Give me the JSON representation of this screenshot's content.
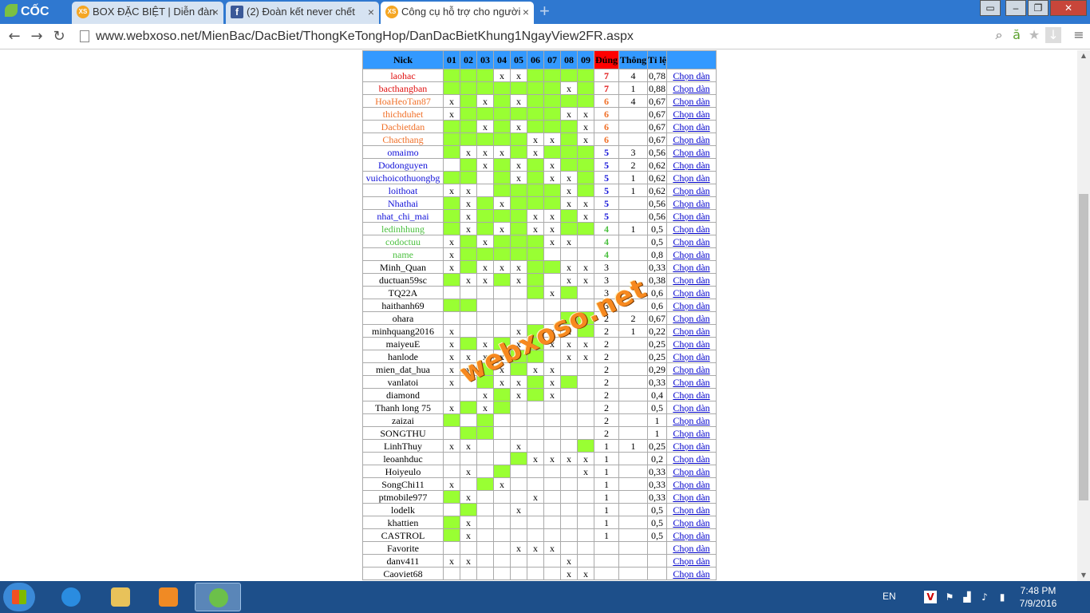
{
  "browser": {
    "brand": "CỐC CỐC",
    "tabs": [
      {
        "label": "BOX ĐẶC BIỆT | Diễn đàn",
        "icon": "xs-icon",
        "fav": "XS"
      },
      {
        "label": "(2) Đoàn kết never chết",
        "icon": "facebook-icon",
        "fav": "f"
      },
      {
        "label": "Công cụ hỗ trợ cho người",
        "icon": "xs-icon",
        "fav": "XS",
        "active": true
      }
    ],
    "url": "www.webxoso.net/MienBac/DacBiet/ThongKeTongHop/DanDacBietKhung1NgayView2FR.aspx"
  },
  "table": {
    "headers": [
      "Nick",
      "01",
      "02",
      "03",
      "04",
      "05",
      "06",
      "07",
      "08",
      "09",
      "Đúng",
      "Thông",
      "Tỉ lệ",
      ""
    ],
    "link_label": "Chọn dàn",
    "rows": [
      {
        "nick": "laohac",
        "color": "red",
        "days": [
          "",
          "",
          "",
          "x",
          "x",
          "",
          "",
          "",
          ""
        ],
        "green": [
          1,
          1,
          1,
          0,
          0,
          1,
          1,
          1,
          1
        ],
        "dung": "7",
        "thong": "4",
        "tile": "0,78"
      },
      {
        "nick": "bacthangban",
        "color": "red",
        "days": [
          "",
          "",
          "",
          "",
          "",
          "",
          "",
          "x",
          ""
        ],
        "green": [
          1,
          1,
          1,
          1,
          1,
          1,
          1,
          0,
          1
        ],
        "dung": "7",
        "thong": "1",
        "tile": "0,88"
      },
      {
        "nick": "HoaHeoTan87",
        "color": "orange",
        "days": [
          "x",
          "",
          "x",
          "",
          "x",
          "",
          "",
          "",
          ""
        ],
        "green": [
          0,
          1,
          0,
          1,
          0,
          1,
          1,
          1,
          1
        ],
        "dung": "6",
        "thong": "4",
        "tile": "0,67"
      },
      {
        "nick": "thichduhet",
        "color": "orange",
        "days": [
          "x",
          "",
          "",
          "",
          "",
          "",
          "",
          "x",
          "x"
        ],
        "green": [
          0,
          1,
          1,
          1,
          1,
          1,
          1,
          0,
          0
        ],
        "dung": "6",
        "thong": "",
        "tile": "0,67"
      },
      {
        "nick": "Dacbietdan",
        "color": "orange",
        "days": [
          "",
          "",
          "x",
          "",
          "x",
          "",
          "",
          "",
          "x"
        ],
        "green": [
          1,
          1,
          0,
          1,
          0,
          1,
          1,
          1,
          0
        ],
        "dung": "6",
        "thong": "",
        "tile": "0,67"
      },
      {
        "nick": "Chacthang",
        "color": "orange",
        "days": [
          "",
          "",
          "",
          "",
          "",
          "x",
          "x",
          "",
          "x"
        ],
        "green": [
          1,
          1,
          1,
          1,
          1,
          0,
          0,
          1,
          0
        ],
        "dung": "6",
        "thong": "",
        "tile": "0,67"
      },
      {
        "nick": "omaimo",
        "color": "blue",
        "days": [
          "",
          "x",
          "x",
          "x",
          "",
          "x",
          "",
          "",
          ""
        ],
        "green": [
          1,
          0,
          0,
          0,
          1,
          0,
          1,
          1,
          1
        ],
        "dung": "5",
        "thong": "3",
        "tile": "0,56"
      },
      {
        "nick": "Dodonguyen",
        "color": "blue",
        "days": [
          "",
          "",
          "x",
          "",
          "x",
          "",
          "x",
          "",
          ""
        ],
        "green": [
          0,
          1,
          0,
          1,
          0,
          1,
          0,
          1,
          1
        ],
        "dung": "5",
        "thong": "2",
        "tile": "0,62"
      },
      {
        "nick": "vuichoicothuongbg",
        "color": "blue",
        "days": [
          "",
          "",
          "",
          "",
          "x",
          "",
          "x",
          "x",
          ""
        ],
        "green": [
          1,
          1,
          0,
          1,
          0,
          1,
          0,
          0,
          1
        ],
        "dung": "5",
        "thong": "1",
        "tile": "0,62"
      },
      {
        "nick": "loithoat",
        "color": "blue",
        "days": [
          "x",
          "x",
          "",
          "",
          "",
          "",
          "",
          "x",
          ""
        ],
        "green": [
          0,
          0,
          0,
          1,
          1,
          1,
          1,
          0,
          1
        ],
        "dung": "5",
        "thong": "1",
        "tile": "0,62"
      },
      {
        "nick": "Nhathai",
        "color": "blue",
        "days": [
          "",
          "x",
          "",
          "x",
          "",
          "",
          "",
          "x",
          "x"
        ],
        "green": [
          1,
          0,
          1,
          0,
          1,
          1,
          1,
          0,
          0
        ],
        "dung": "5",
        "thong": "",
        "tile": "0,56"
      },
      {
        "nick": "nhat_chi_mai",
        "color": "blue",
        "days": [
          "",
          "x",
          "",
          "",
          "",
          "x",
          "x",
          "",
          "x"
        ],
        "green": [
          1,
          0,
          1,
          1,
          1,
          0,
          0,
          1,
          0
        ],
        "dung": "5",
        "thong": "",
        "tile": "0,56"
      },
      {
        "nick": "ledinhhung",
        "color": "green",
        "days": [
          "",
          "x",
          "",
          "x",
          "",
          "x",
          "x",
          "",
          ""
        ],
        "green": [
          1,
          0,
          1,
          0,
          1,
          0,
          0,
          1,
          1
        ],
        "dung": "4",
        "thong": "1",
        "tile": "0,5"
      },
      {
        "nick": "codoctuu",
        "color": "green",
        "days": [
          "x",
          "",
          "x",
          "",
          "",
          "",
          "x",
          "x",
          ""
        ],
        "green": [
          0,
          1,
          0,
          1,
          1,
          1,
          0,
          0,
          0
        ],
        "dung": "4",
        "thong": "",
        "tile": "0,5"
      },
      {
        "nick": "name",
        "color": "green",
        "days": [
          "x",
          "",
          "",
          "",
          "",
          "",
          "",
          "",
          ""
        ],
        "green": [
          0,
          1,
          1,
          1,
          1,
          1,
          0,
          0,
          0
        ],
        "dung": "4",
        "thong": "",
        "tile": "0,8"
      },
      {
        "nick": "Minh_Quan",
        "color": "black",
        "days": [
          "x",
          "",
          "x",
          "x",
          "x",
          "",
          "",
          "x",
          "x"
        ],
        "green": [
          0,
          1,
          0,
          0,
          0,
          1,
          1,
          0,
          0
        ],
        "dung": "3",
        "thong": "",
        "tile": "0,33"
      },
      {
        "nick": "ductuan59sc",
        "color": "black",
        "days": [
          "",
          "x",
          "x",
          "",
          "x",
          "",
          "",
          "x",
          "x"
        ],
        "green": [
          1,
          0,
          0,
          1,
          0,
          1,
          0,
          0,
          0
        ],
        "dung": "3",
        "thong": "",
        "tile": "0,38"
      },
      {
        "nick": "TQ22A",
        "color": "black",
        "days": [
          "",
          "",
          "",
          "",
          "",
          "",
          "x",
          "",
          ""
        ],
        "green": [
          0,
          0,
          0,
          0,
          0,
          1,
          0,
          1,
          0
        ],
        "dung": "3",
        "thong": "",
        "tile": "0,6"
      },
      {
        "nick": "haithanh69",
        "color": "black",
        "days": [
          "",
          "",
          "",
          "",
          "",
          "",
          "",
          "",
          ""
        ],
        "green": [
          1,
          1,
          0,
          0,
          0,
          0,
          0,
          0,
          0
        ],
        "dung": "3",
        "thong": "",
        "tile": "0,6"
      },
      {
        "nick": "ohara",
        "color": "black",
        "days": [
          "",
          "",
          "",
          "",
          "",
          "",
          "",
          "",
          ""
        ],
        "green": [
          0,
          0,
          0,
          0,
          0,
          0,
          0,
          1,
          1
        ],
        "dung": "2",
        "thong": "2",
        "tile": "0,67"
      },
      {
        "nick": "minhquang2016",
        "color": "black",
        "days": [
          "x",
          "",
          "",
          "",
          "x",
          "",
          "x",
          "x",
          ""
        ],
        "green": [
          0,
          0,
          0,
          0,
          0,
          1,
          0,
          0,
          1
        ],
        "dung": "2",
        "thong": "1",
        "tile": "0,22"
      },
      {
        "nick": "maiyeuE",
        "color": "black",
        "days": [
          "x",
          "",
          "x",
          "",
          "x",
          "",
          "x",
          "x",
          "x"
        ],
        "green": [
          0,
          1,
          0,
          1,
          0,
          1,
          0,
          0,
          0
        ],
        "dung": "2",
        "thong": "",
        "tile": "0,25"
      },
      {
        "nick": "hanlode",
        "color": "black",
        "days": [
          "x",
          "x",
          "x",
          "x",
          "",
          "",
          "",
          "x",
          "x"
        ],
        "green": [
          0,
          0,
          0,
          0,
          1,
          1,
          0,
          0,
          0
        ],
        "dung": "2",
        "thong": "",
        "tile": "0,25"
      },
      {
        "nick": "mien_dat_hua",
        "color": "black",
        "days": [
          "x",
          "x",
          "",
          "x",
          "",
          "x",
          "x",
          "",
          ""
        ],
        "green": [
          0,
          0,
          1,
          0,
          1,
          0,
          0,
          0,
          0
        ],
        "dung": "2",
        "thong": "",
        "tile": "0,29"
      },
      {
        "nick": "vanlatoi",
        "color": "black",
        "days": [
          "x",
          "",
          "",
          "x",
          "x",
          "",
          "x",
          "",
          ""
        ],
        "green": [
          0,
          0,
          1,
          0,
          0,
          1,
          0,
          1,
          0
        ],
        "dung": "2",
        "thong": "",
        "tile": "0,33"
      },
      {
        "nick": "diamond",
        "color": "black",
        "days": [
          "",
          "",
          "x",
          "",
          "x",
          "",
          "x",
          "",
          ""
        ],
        "green": [
          0,
          0,
          0,
          1,
          0,
          1,
          0,
          0,
          0
        ],
        "dung": "2",
        "thong": "",
        "tile": "0,4"
      },
      {
        "nick": "Thanh long 75",
        "color": "black",
        "days": [
          "x",
          "",
          "x",
          "",
          "",
          "",
          "",
          "",
          ""
        ],
        "green": [
          0,
          1,
          0,
          1,
          0,
          0,
          0,
          0,
          0
        ],
        "dung": "2",
        "thong": "",
        "tile": "0,5"
      },
      {
        "nick": "zaizai",
        "color": "black",
        "days": [
          "",
          "",
          "",
          "",
          "",
          "",
          "",
          "",
          ""
        ],
        "green": [
          1,
          0,
          1,
          0,
          0,
          0,
          0,
          0,
          0
        ],
        "dung": "2",
        "thong": "",
        "tile": "1"
      },
      {
        "nick": "SONGTHU",
        "color": "black",
        "days": [
          "",
          "",
          "",
          "",
          "",
          "",
          "",
          "",
          ""
        ],
        "green": [
          0,
          1,
          1,
          0,
          0,
          0,
          0,
          0,
          0
        ],
        "dung": "2",
        "thong": "",
        "tile": "1"
      },
      {
        "nick": "LinhThuy",
        "color": "black",
        "days": [
          "x",
          "x",
          "",
          "",
          "x",
          "",
          "",
          "",
          ""
        ],
        "green": [
          0,
          0,
          0,
          0,
          0,
          0,
          0,
          0,
          1
        ],
        "dung": "1",
        "thong": "1",
        "tile": "0,25"
      },
      {
        "nick": "leoanhduc",
        "color": "black",
        "days": [
          "",
          "",
          "",
          "",
          "",
          "x",
          "x",
          "x",
          "x"
        ],
        "green": [
          0,
          0,
          0,
          0,
          1,
          0,
          0,
          0,
          0
        ],
        "dung": "1",
        "thong": "",
        "tile": "0,2"
      },
      {
        "nick": "Hoiyeulo",
        "color": "black",
        "days": [
          "",
          "x",
          "",
          "",
          "",
          "",
          "",
          "",
          "x"
        ],
        "green": [
          0,
          0,
          0,
          1,
          0,
          0,
          0,
          0,
          0
        ],
        "dung": "1",
        "thong": "",
        "tile": "0,33"
      },
      {
        "nick": "SongChi11",
        "color": "black",
        "days": [
          "x",
          "",
          "",
          "x",
          "",
          "",
          "",
          "",
          ""
        ],
        "green": [
          0,
          0,
          1,
          0,
          0,
          0,
          0,
          0,
          0
        ],
        "dung": "1",
        "thong": "",
        "tile": "0,33"
      },
      {
        "nick": "ptmobile977",
        "color": "black",
        "days": [
          "",
          "x",
          "",
          "",
          "",
          "x",
          "",
          "",
          ""
        ],
        "green": [
          1,
          0,
          0,
          0,
          0,
          0,
          0,
          0,
          0
        ],
        "dung": "1",
        "thong": "",
        "tile": "0,33"
      },
      {
        "nick": "lodelk",
        "color": "black",
        "days": [
          "",
          "",
          "",
          "",
          "x",
          "",
          "",
          "",
          ""
        ],
        "green": [
          0,
          1,
          0,
          0,
          0,
          0,
          0,
          0,
          0
        ],
        "dung": "1",
        "thong": "",
        "tile": "0,5"
      },
      {
        "nick": "khattien",
        "color": "black",
        "days": [
          "",
          "x",
          "",
          "",
          "",
          "",
          "",
          "",
          ""
        ],
        "green": [
          1,
          0,
          0,
          0,
          0,
          0,
          0,
          0,
          0
        ],
        "dung": "1",
        "thong": "",
        "tile": "0,5"
      },
      {
        "nick": "CASTROL",
        "color": "black",
        "days": [
          "",
          "x",
          "",
          "",
          "",
          "",
          "",
          "",
          ""
        ],
        "green": [
          1,
          0,
          0,
          0,
          0,
          0,
          0,
          0,
          0
        ],
        "dung": "1",
        "thong": "",
        "tile": "0,5"
      },
      {
        "nick": "Favorite",
        "color": "black",
        "days": [
          "",
          "",
          "",
          "",
          "x",
          "x",
          "x",
          "",
          ""
        ],
        "green": [
          0,
          0,
          0,
          0,
          0,
          0,
          0,
          0,
          0
        ],
        "dung": "",
        "thong": "",
        "tile": ""
      },
      {
        "nick": "danv411",
        "color": "black",
        "days": [
          "x",
          "x",
          "",
          "",
          "",
          "",
          "",
          "x",
          ""
        ],
        "green": [
          0,
          0,
          0,
          0,
          0,
          0,
          0,
          0,
          0
        ],
        "dung": "",
        "thong": "",
        "tile": ""
      },
      {
        "nick": "Caoviet68",
        "color": "black",
        "days": [
          "",
          "",
          "",
          "",
          "",
          "",
          "",
          "x",
          "x"
        ],
        "green": [
          0,
          0,
          0,
          0,
          0,
          0,
          0,
          0,
          0
        ],
        "dung": "",
        "thong": "",
        "tile": ""
      }
    ]
  },
  "watermark": "webxoso.net",
  "taskbar": {
    "lang": "EN",
    "time": "7:48 PM",
    "date": "7/9/2016"
  }
}
